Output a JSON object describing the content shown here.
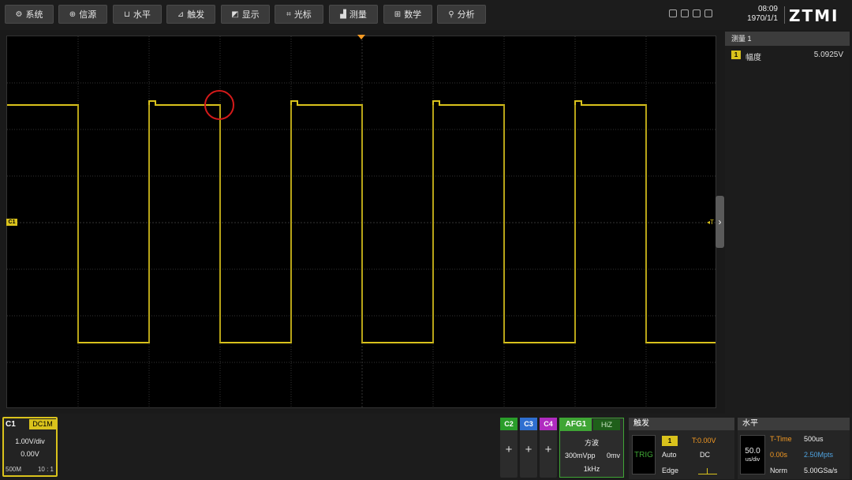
{
  "menu": [
    {
      "label": "系统",
      "icon": "gear-icon",
      "glyph": "⚙"
    },
    {
      "label": "信源",
      "icon": "source-icon",
      "glyph": "⊕"
    },
    {
      "label": "水平",
      "icon": "horizontal-icon",
      "glyph": "⊔"
    },
    {
      "label": "触发",
      "icon": "trigger-icon",
      "glyph": "⊿"
    },
    {
      "label": "显示",
      "icon": "display-icon",
      "glyph": "◩"
    },
    {
      "label": "光标",
      "icon": "cursor-icon",
      "glyph": "⌗"
    },
    {
      "label": "测量",
      "icon": "measure-icon",
      "glyph": "▟"
    },
    {
      "label": "数学",
      "icon": "math-icon",
      "glyph": "⊞"
    },
    {
      "label": "分析",
      "icon": "search-icon",
      "glyph": "⚲"
    }
  ],
  "clock": {
    "time": "08:09",
    "date": "1970/1/1"
  },
  "brand": {
    "logo": "ZTMI"
  },
  "channel1": {
    "label": "C1",
    "coupling": "DC1M",
    "scale": "1.00V/div",
    "offset": "0.00V",
    "bandwidth": "500M",
    "probe": "10 : 1",
    "marker": "C1"
  },
  "other_channels": [
    {
      "label": "C2",
      "color": "#2a9d2a"
    },
    {
      "label": "C3",
      "color": "#2f6fd0"
    },
    {
      "label": "C4",
      "color": "#b02cc0"
    }
  ],
  "add_glyph": "+",
  "afg": {
    "label": "AFG1",
    "impedance": "HiZ",
    "waveform": "方波",
    "amplitude": "300mVpp",
    "offset": "0mv",
    "frequency": "1kHz"
  },
  "trigger": {
    "title": "触发",
    "tag": "TRIG",
    "source": "1",
    "level": "T:0.00V",
    "mode": "Auto",
    "coupling": "DC",
    "type": "Edge",
    "level_marker": "◂T"
  },
  "horizontal": {
    "title": "水平",
    "scale": "50.0",
    "scale_unit": "us/div",
    "t_time_label": "T-Time",
    "t_time_value": "500us",
    "position": "0.00s",
    "memory_depth": "2.50Mpts",
    "acq_mode": "Norm",
    "sample_rate": "5.00GSa/s"
  },
  "measurement": {
    "header": "测量 1",
    "source": "1",
    "name": "幅度",
    "value": "5.0925V"
  },
  "colors": {
    "ch1": "#d9c21c",
    "afg": "#3fa535",
    "trigger_level": "#f59a23",
    "annotation": "#d51a1a"
  }
}
